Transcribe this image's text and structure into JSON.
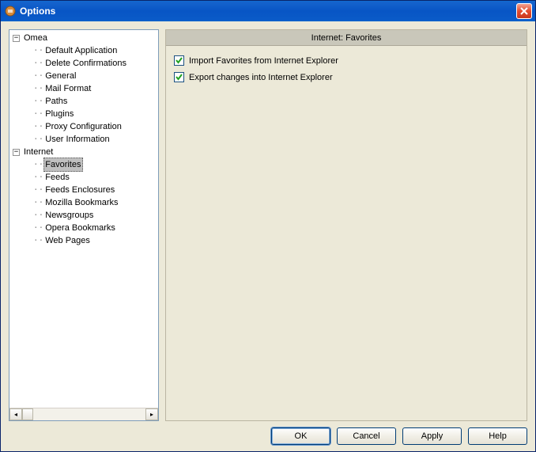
{
  "window": {
    "title": "Options"
  },
  "tree": {
    "root1": {
      "label": "Omea",
      "children": [
        "Default Application",
        "Delete Confirmations",
        "General",
        "Mail Format",
        "Paths",
        "Plugins",
        "Proxy Configuration",
        "User Information"
      ]
    },
    "root2": {
      "label": "Internet",
      "children": [
        "Favorites",
        "Feeds",
        "Feeds Enclosures",
        "Mozilla Bookmarks",
        "Newsgroups",
        "Opera Bookmarks",
        "Web Pages"
      ],
      "selected": "Favorites"
    }
  },
  "main": {
    "header": "Internet: Favorites",
    "checks": {
      "import": {
        "label": "Import Favorites from Internet Explorer",
        "checked": true
      },
      "export": {
        "label": "Export changes into Internet Explorer",
        "checked": true
      }
    }
  },
  "buttons": {
    "ok": "OK",
    "cancel": "Cancel",
    "apply": "Apply",
    "help": "Help"
  }
}
